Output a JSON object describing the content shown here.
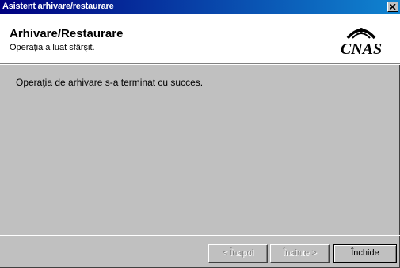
{
  "window": {
    "title": "Asistent arhivare/restaurare"
  },
  "header": {
    "title": "Arhivare/Restaurare",
    "subtitle": "Operaţia a luat sfârşit.",
    "logo_text": "CNAS"
  },
  "body": {
    "message": "Operaţia de arhivare s-a terminat cu succes."
  },
  "buttons": {
    "back": "< Înapoi",
    "next": "Înainte >",
    "close": "Închide"
  },
  "colors": {
    "titlebar": "#000080",
    "dialog_bg": "#c0c0c0",
    "disabled_text": "#808080"
  }
}
